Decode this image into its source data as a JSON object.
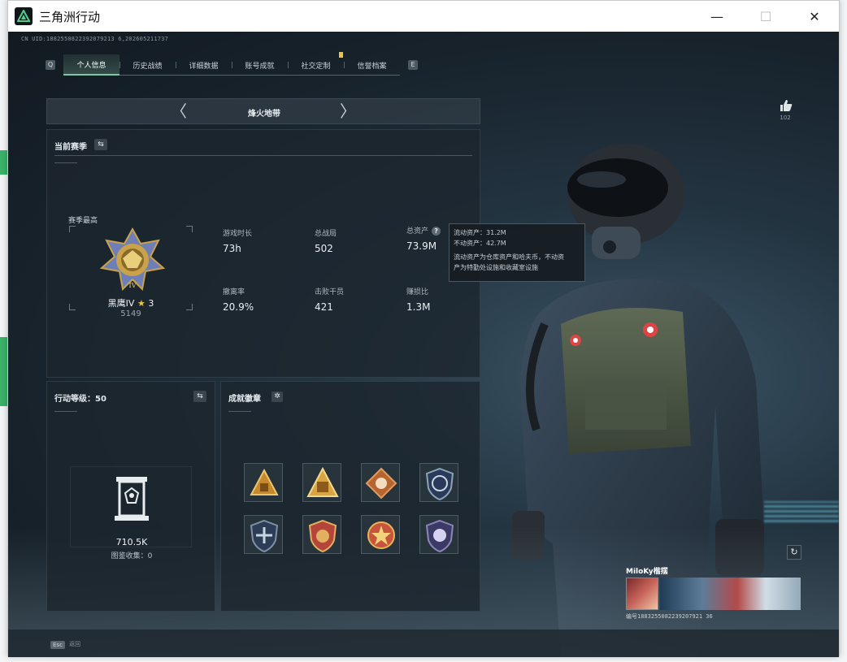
{
  "window": {
    "title": "三角洲行动",
    "controls": {
      "minimize": "—",
      "maximize": "☐",
      "close": "✕"
    }
  },
  "header": {
    "uid_line": "CN UID:1882550822392079213 6,202605211737",
    "tabs": [
      {
        "label": "个人信息",
        "active": true
      },
      {
        "label": "历史战绩",
        "active": false
      },
      {
        "label": "详细数据",
        "active": false
      },
      {
        "label": "账号成就",
        "active": false
      },
      {
        "label": "社交定制",
        "active": false
      },
      {
        "label": "信誉档案",
        "active": false
      }
    ],
    "prev_key": "Q",
    "next_key": "E"
  },
  "map_selector": {
    "title": "烽火地带",
    "prev": "〈",
    "next": "〉"
  },
  "season": {
    "heading": "当前赛季",
    "swap_icon": "⇆",
    "rank_label": "赛季最高",
    "rank_name": "黑鹰IV",
    "rank_star": "★",
    "rank_stars": "3",
    "rank_score": "5149",
    "stats": [
      {
        "label": "游戏时长",
        "value": "73h"
      },
      {
        "label": "总战局",
        "value": "502"
      },
      {
        "label": "总资产",
        "value": "73.9M",
        "help": "?"
      },
      {
        "label": "撤离率",
        "value": "20.9%"
      },
      {
        "label": "击败干员",
        "value": "421"
      },
      {
        "label": "赚损比",
        "value": "1.3M"
      }
    ]
  },
  "tooltip": {
    "line1": "流动资产：31.2M",
    "line2": "不动资产：42.7M",
    "line3": "流动资产为仓库资产和哈夫币，不动资",
    "line4": "产为特勤处设施和收藏室设施"
  },
  "level_panel": {
    "heading": "行动等级：50",
    "swap_icon": "⇆",
    "value": "710.5K",
    "subtitle": "图鉴收集：0"
  },
  "badges_panel": {
    "heading": "成就徽章",
    "gear_icon": "✲",
    "badges": [
      {
        "name": "triangle-gold-badge",
        "color": "#c58a2e"
      },
      {
        "name": "triangle-bag-badge",
        "color": "#d9a441"
      },
      {
        "name": "diamond-brown-badge",
        "color": "#b5652f"
      },
      {
        "name": "shield-steel-badge",
        "color": "#8da4b6"
      },
      {
        "name": "shield-blue-badge",
        "color": "#7d92a6"
      },
      {
        "name": "shield-red-badge",
        "color": "#b5453a"
      },
      {
        "name": "star-medal-badge",
        "color": "#c7543c"
      },
      {
        "name": "shield-purple-badge",
        "color": "#8c86b8"
      }
    ]
  },
  "social": {
    "like_count": "102"
  },
  "player_card": {
    "name": "MiloKy楷摆",
    "id_line": "编号1883255082239207921 36"
  },
  "footer": {
    "esc_key": "Esc",
    "esc_label": "返回"
  }
}
